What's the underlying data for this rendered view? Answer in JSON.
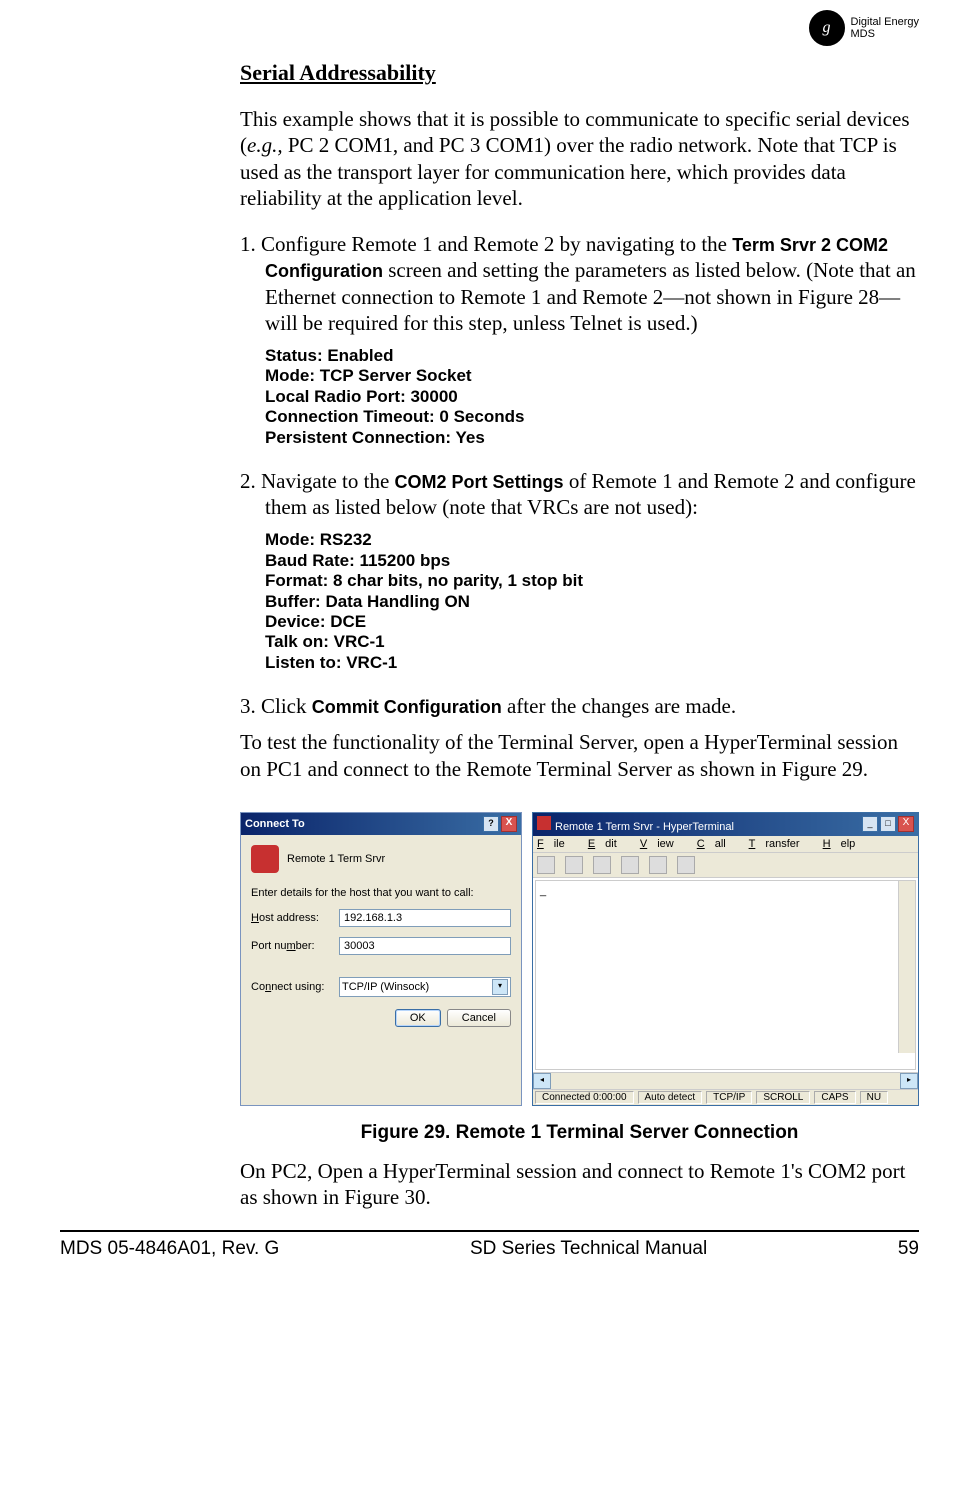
{
  "brand": {
    "monogram": "g",
    "line1": "Digital Energy",
    "line2": "MDS"
  },
  "section_title": "Serial Addressability",
  "intro_part1": "This example shows that it is possible to communicate to specific serial devices (",
  "intro_italic": "e.g.,",
  "intro_part2": " PC 2 COM1, and PC 3 COM1) over the radio network. Note that TCP is used as the transport layer for communication here, which provides data reliability at the application level.",
  "step1": {
    "num": "1.",
    "text_a": "  Configure Remote 1 and Remote 2 by navigating to the ",
    "bold1": "Term Srvr 2 COM2 Configuration",
    "text_b": " screen and setting the parameters as listed below. (Note that an Ethernet connection to Remote 1 and Remote 2—not shown in Figure 28— will be required for this step, unless Telnet is used.)"
  },
  "config1": {
    "l1": "Status:  Enabled",
    "l2": "Mode:  TCP Server Socket",
    "l3": "Local Radio Port:  30000",
    "l4": "Connection Timeout:  0 Seconds",
    "l5": "Persistent Connection:  Yes"
  },
  "step2": {
    "num": "2.",
    "text_a": "  Navigate to the ",
    "bold1": "COM2 Port Settings",
    "text_b": " of Remote 1 and Remote 2 and configure them as listed below (note that VRCs are not used):"
  },
  "config2": {
    "l1": "Mode:  RS232",
    "l2": "Baud Rate:  115200 bps",
    "l3": "Format:  8 char bits, no parity, 1 stop bit",
    "l4": "Buffer:  Data Handling ON",
    "l5": "Device:  DCE",
    "l6": "Talk on:  VRC-1",
    "l7": "Listen to:  VRC-1"
  },
  "step3": {
    "num": "3.",
    "text_a": "  Click ",
    "bold1": "Commit Configuration",
    "text_b": " after the changes are made."
  },
  "test_para": "To test the functionality of the Terminal Server, open a HyperTerminal session on PC1 and connect to the Remote Terminal Server as shown in Figure 29.",
  "dialog": {
    "title": "Connect To",
    "help": "?",
    "close": "X",
    "session_name": "Remote 1 Term Srvr",
    "prompt": "Enter details for the host that you want to call:",
    "host_label_u": "H",
    "host_label_rest": "ost address:",
    "host_value": "192.168.1.3",
    "port_label_pre": "Port nu",
    "port_label_u": "m",
    "port_label_post": "ber:",
    "port_value": "30003",
    "conn_label_pre": "Co",
    "conn_label_u": "n",
    "conn_label_post": "nect using:",
    "conn_value": "TCP/IP (Winsock)",
    "ok": "OK",
    "cancel": "Cancel"
  },
  "hyper": {
    "title": "Remote 1 Term Srvr - HyperTerminal",
    "menu": {
      "file_u": "F",
      "file": "ile",
      "edit_u": "E",
      "edit": "dit",
      "view_u": "V",
      "view": "iew",
      "call_u": "C",
      "call": "all",
      "transfer_u": "T",
      "transfer": "ransfer",
      "help_u": "H",
      "help": "elp"
    },
    "body_char": "_",
    "status": {
      "s1": "Connected 0:00:00",
      "s2": "Auto detect",
      "s3": "TCP/IP",
      "s4": "SCROLL",
      "s5": "CAPS",
      "s6": "NU"
    }
  },
  "fig_caption": "Figure 29. Remote 1 Terminal Server Connection",
  "closing_para": "On PC2, Open a HyperTerminal session and connect to Remote 1's COM2 port as shown in Figure 30.",
  "footer": {
    "left": "MDS 05-4846A01, Rev. G",
    "center": "SD Series Technical Manual",
    "right": "59"
  }
}
